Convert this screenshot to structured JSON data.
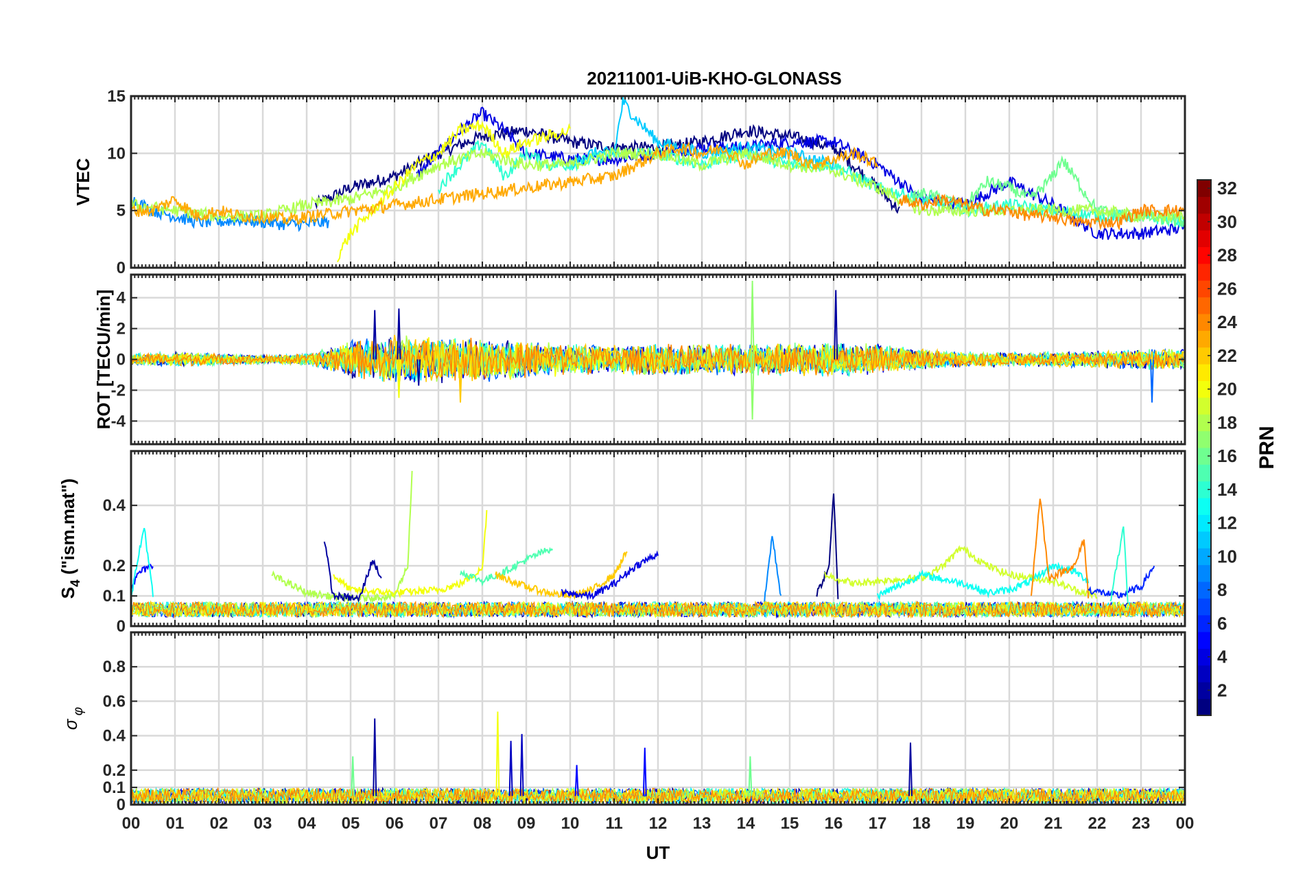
{
  "chart_data": {
    "type": "line",
    "title": "20211001-UiB-KHO-GLONASS",
    "xlabel": "UT",
    "x_ticks": [
      "00",
      "01",
      "02",
      "03",
      "04",
      "05",
      "06",
      "07",
      "08",
      "09",
      "10",
      "11",
      "12",
      "13",
      "14",
      "15",
      "16",
      "17",
      "18",
      "19",
      "20",
      "21",
      "22",
      "23",
      "00"
    ],
    "xlim": [
      0,
      24
    ],
    "grid": true,
    "panels": [
      {
        "id": "vtec",
        "ylabel": "VTEC",
        "ylim": [
          0,
          15
        ],
        "yticks": [
          0,
          5,
          10,
          15
        ],
        "ytick_labels": [
          "0",
          "5",
          "10",
          "15"
        ],
        "series": [
          {
            "prn": 1,
            "hours": [
              4.2,
              5,
              6,
              7,
              8,
              9,
              10,
              11,
              12,
              13,
              14,
              15,
              16,
              17,
              17.5
            ],
            "values": [
              5.5,
              7,
              8,
              10,
              11.5,
              12,
              11,
              10.5,
              10.5,
              11,
              12,
              11.5,
              10.5,
              7,
              5
            ]
          },
          {
            "prn": 4,
            "hours": [
              6.5,
              7.5,
              8,
              8.5,
              9,
              10,
              11,
              12,
              13,
              14,
              15,
              16,
              17,
              18,
              19,
              20,
              21,
              22,
              23,
              24
            ],
            "values": [
              8,
              12,
              13.5,
              12,
              10,
              9.5,
              9.5,
              10,
              10.5,
              10.5,
              11,
              11,
              9,
              6,
              5.5,
              7.5,
              5.5,
              3,
              3,
              3.5
            ]
          },
          {
            "prn": 9,
            "hours": [
              0,
              0.5,
              1,
              1.5,
              2,
              2.5,
              3,
              3.5,
              4,
              4.5
            ],
            "values": [
              6,
              5,
              4.5,
              4,
              4,
              4.2,
              4,
              3.8,
              3.8,
              4
            ]
          },
          {
            "prn": 11,
            "hours": [
              10,
              10.5,
              11,
              11.2,
              11.5,
              12,
              13,
              14,
              15,
              16
            ],
            "values": [
              9,
              10,
              10,
              14.5,
              13,
              11,
              10,
              10.5,
              10,
              9
            ]
          },
          {
            "prn": 14,
            "hours": [
              7,
              7.5,
              8,
              8.5,
              9,
              9.5,
              10,
              11,
              12,
              13,
              14,
              15,
              16,
              17,
              18,
              19,
              20,
              21,
              22,
              23,
              24
            ],
            "values": [
              7,
              9,
              11,
              8,
              10,
              9,
              9,
              10,
              10,
              9,
              10,
              9,
              9,
              7,
              6,
              5,
              5.5,
              5,
              4.5,
              4.5,
              4
            ]
          },
          {
            "prn": 16,
            "hours": [
              17.8,
              18,
              19,
              19.5,
              20,
              20.5,
              21,
              21.2,
              22,
              23,
              24
            ],
            "values": [
              6,
              6.5,
              5.5,
              7.5,
              7,
              6,
              8,
              9.5,
              5,
              4.5,
              4
            ]
          },
          {
            "prn": 18,
            "hours": [
              0,
              1,
              2,
              3,
              4,
              5,
              6,
              7,
              8,
              9,
              10,
              11,
              12,
              13,
              14,
              15,
              16,
              17,
              18,
              19,
              20,
              21,
              22,
              23,
              24
            ],
            "values": [
              5.5,
              5,
              4.5,
              4.5,
              5.5,
              6,
              7,
              9,
              10,
              9,
              9,
              10,
              10,
              9,
              10,
              9,
              8.5,
              7,
              5,
              5,
              5,
              5,
              5,
              4.5,
              4.5
            ]
          },
          {
            "prn": 20,
            "hours": [
              4.7,
              5,
              5.5,
              6,
              6.5,
              7,
              7.5,
              8,
              8.5,
              9,
              9.5,
              10
            ],
            "values": [
              1,
              3,
              5,
              7,
              9,
              10,
              12,
              12.5,
              10,
              11,
              11.5,
              12
            ]
          },
          {
            "prn": 23,
            "hours": [
              0,
              0.5,
              1,
              1.5,
              2,
              2.5,
              3,
              3.5,
              11,
              11.5,
              12,
              12.5,
              13,
              13.5,
              14,
              14.5,
              15,
              15.5,
              16,
              16.5,
              17
            ],
            "values": [
              5,
              5,
              6,
              4.5,
              5,
              4.5,
              4.5,
              4.2,
              8,
              9,
              10,
              10.5,
              10,
              10.5,
              9,
              10,
              10,
              9,
              9.5,
              10,
              9
            ]
          },
          {
            "prn": 24,
            "hours": [
              17.5,
              18,
              18.5,
              19,
              19.5,
              20,
              20.5,
              21,
              21.5,
              22,
              22.5,
              23,
              23.5,
              24
            ],
            "values": [
              6,
              5.5,
              6,
              5.5,
              5,
              5,
              4.5,
              4.5,
              4,
              4,
              4,
              5,
              5,
              5
            ]
          }
        ]
      },
      {
        "id": "rot",
        "ylabel": "ROT [TECU/min]",
        "ylim": [
          -5.5,
          5.5
        ],
        "yticks": [
          -4,
          -2,
          0,
          2,
          4
        ],
        "ytick_labels": [
          "-4",
          "-2",
          "0",
          "2",
          "4"
        ],
        "activity_envelope": {
          "hours": [
            0,
            1,
            2,
            3,
            4,
            4.5,
            5,
            6,
            7,
            8,
            9,
            10,
            11,
            12,
            13,
            14,
            15,
            16,
            17,
            18,
            19,
            20,
            21,
            22,
            23,
            24
          ],
          "amplitude": [
            0.4,
            0.5,
            0.4,
            0.3,
            0.4,
            0.8,
            1.3,
            1.6,
            1.6,
            1.5,
            1.3,
            1.1,
            1.0,
            1.1,
            1.0,
            1.1,
            1.1,
            1.2,
            1.0,
            0.7,
            0.5,
            0.5,
            0.5,
            0.6,
            0.7,
            0.7
          ]
        },
        "spikes": [
          {
            "prn": 2,
            "hour": 5.55,
            "value": 3.2
          },
          {
            "prn": 2,
            "hour": 6.1,
            "value": 3.3
          },
          {
            "prn": 2,
            "hour": 6.55,
            "value": -1.7
          },
          {
            "prn": 17,
            "hour": 14.15,
            "value": 5.1
          },
          {
            "prn": 17,
            "hour": 14.15,
            "value": -3.9
          },
          {
            "prn": 2,
            "hour": 16.05,
            "value": 4.5
          },
          {
            "prn": 8,
            "hour": 23.25,
            "value": -2.8
          },
          {
            "prn": 22,
            "hour": 7.5,
            "value": -2.8
          },
          {
            "prn": 20,
            "hour": 6.1,
            "value": -2.5
          }
        ]
      },
      {
        "id": "s4",
        "ylabel": "S4 (\"ism.mat\")",
        "ylabel_base": "S",
        "ylabel_sub": "4",
        "ylabel_rest": " (\"ism.mat\")",
        "ylim": [
          0,
          0.58
        ],
        "yticks": [
          0,
          0.1,
          0.2,
          0.4
        ],
        "ytick_labels": [
          "0",
          "0.1",
          "0.2",
          "0.4"
        ],
        "series": [
          {
            "prn": 5,
            "hours": [
              0,
              0.2,
              0.5
            ],
            "values": [
              0.13,
              0.18,
              0.2
            ]
          },
          {
            "prn": 13,
            "hours": [
              0,
              0.3,
              0.5
            ],
            "values": [
              0.1,
              0.33,
              0.1
            ]
          },
          {
            "prn": 18,
            "hours": [
              3.2,
              4,
              4.5,
              5,
              6,
              6.3,
              6.4
            ],
            "values": [
              0.17,
              0.11,
              0.1,
              0.09,
              0.1,
              0.2,
              0.51
            ]
          },
          {
            "prn": 20,
            "hours": [
              4.6,
              5,
              6,
              7,
              7.5,
              8,
              8.1
            ],
            "values": [
              0.17,
              0.12,
              0.11,
              0.12,
              0.14,
              0.19,
              0.38
            ]
          },
          {
            "prn": 15,
            "hours": [
              7.5,
              8,
              8.5,
              9,
              9.6
            ],
            "values": [
              0.18,
              0.15,
              0.18,
              0.22,
              0.26
            ]
          },
          {
            "prn": 22,
            "hours": [
              8.3,
              9,
              9.5,
              10,
              10.5,
              11,
              11.3
            ],
            "values": [
              0.17,
              0.13,
              0.11,
              0.1,
              0.12,
              0.17,
              0.25
            ]
          },
          {
            "prn": 4,
            "hours": [
              9.8,
              10.5,
              11,
              11.5,
              12
            ],
            "values": [
              0.11,
              0.1,
              0.14,
              0.2,
              0.24
            ]
          },
          {
            "prn": 2,
            "hours": [
              4.4,
              4.6,
              5.2,
              5.5,
              5.7
            ],
            "values": [
              0.29,
              0.1,
              0.09,
              0.22,
              0.16
            ]
          },
          {
            "prn": 9,
            "hours": [
              14.4,
              14.6,
              14.8
            ],
            "values": [
              0.05,
              0.3,
              0.1
            ]
          },
          {
            "prn": 1,
            "hours": [
              15.6,
              15.9,
              16.0,
              16.1
            ],
            "values": [
              0.1,
              0.2,
              0.44,
              0.1
            ]
          },
          {
            "prn": 19,
            "hours": [
              15.8,
              16.5,
              17,
              18,
              18.5,
              18.9,
              19.5,
              20,
              21,
              21.5,
              22
            ],
            "values": [
              0.17,
              0.14,
              0.15,
              0.16,
              0.2,
              0.26,
              0.2,
              0.17,
              0.15,
              0.12,
              0.1
            ]
          },
          {
            "prn": 13,
            "hours": [
              17,
              18,
              19,
              19.5,
              20,
              20.5,
              21,
              21.5,
              21.8
            ],
            "values": [
              0.1,
              0.17,
              0.14,
              0.11,
              0.12,
              0.15,
              0.2,
              0.18,
              0.15
            ]
          },
          {
            "prn": 24,
            "hours": [
              20.5,
              20.7,
              20.9,
              21.5,
              21.7,
              21.8
            ],
            "values": [
              0.1,
              0.43,
              0.16,
              0.2,
              0.29,
              0.1
            ]
          },
          {
            "prn": 6,
            "hours": [
              21.8,
              22.5,
              23,
              23.3
            ],
            "values": [
              0.12,
              0.1,
              0.13,
              0.2
            ]
          },
          {
            "prn": 14,
            "hours": [
              22.3,
              22.5,
              22.6,
              22.7
            ],
            "values": [
              0.08,
              0.24,
              0.33,
              0.08
            ]
          }
        ]
      },
      {
        "id": "sigma_phi",
        "ylabel": "σ φ",
        "ylabel_base": "σ",
        "ylabel_sub": "φ",
        "ylim": [
          0,
          1.0
        ],
        "yticks": [
          0,
          0.1,
          0.2,
          0.4,
          0.6,
          0.8
        ],
        "ytick_labels": [
          "0",
          "0.1",
          "0.2",
          "0.4",
          "0.6",
          "0.8"
        ],
        "spikes": [
          {
            "prn": 2,
            "hour": 5.55,
            "value": 0.5
          },
          {
            "prn": 16,
            "hour": 5.05,
            "value": 0.28
          },
          {
            "prn": 20,
            "hour": 8.35,
            "value": 0.54
          },
          {
            "prn": 3,
            "hour": 8.65,
            "value": 0.37
          },
          {
            "prn": 3,
            "hour": 8.9,
            "value": 0.41
          },
          {
            "prn": 5,
            "hour": 10.15,
            "value": 0.23
          },
          {
            "prn": 5,
            "hour": 11.7,
            "value": 0.33
          },
          {
            "prn": 16,
            "hour": 14.1,
            "value": 0.28
          },
          {
            "prn": 2,
            "hour": 17.75,
            "value": 0.36
          }
        ]
      }
    ],
    "colorbar": {
      "label": "PRN",
      "min": 1,
      "max": 32,
      "ticks": [
        2,
        4,
        6,
        8,
        10,
        12,
        14,
        16,
        18,
        20,
        22,
        24,
        26,
        28,
        30,
        32
      ],
      "colormap": "jet"
    }
  }
}
